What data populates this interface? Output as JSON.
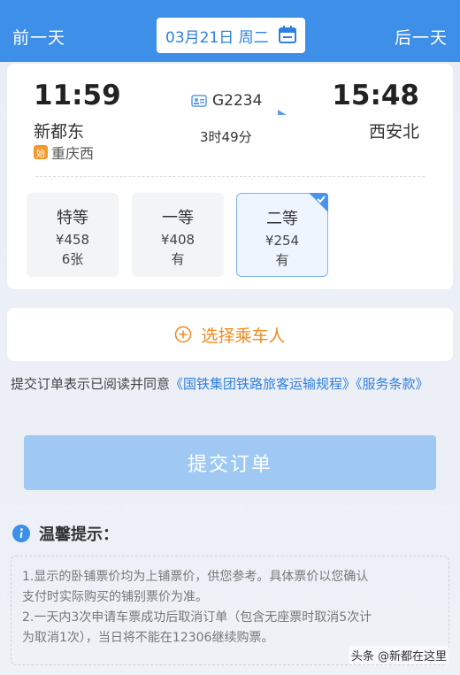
{
  "header": {
    "prev_label": "前一天",
    "next_label": "后一天",
    "date": "03月21日 周二"
  },
  "trip": {
    "dep_time": "11:59",
    "dep_station": "新都东",
    "origin_badge": "始",
    "origin_station": "重庆西",
    "train_no": "G2234",
    "duration": "3时49分",
    "arr_time": "15:48",
    "arr_station": "西安北"
  },
  "seats": [
    {
      "name": "特等",
      "price": "¥458",
      "avail": "6张",
      "selected": false
    },
    {
      "name": "一等",
      "price": "¥408",
      "avail": "有",
      "selected": false
    },
    {
      "name": "二等",
      "price": "¥254",
      "avail": "有",
      "selected": true
    }
  ],
  "passenger": {
    "select_label": "选择乘车人"
  },
  "agreement": {
    "prefix": "提交订单表示已阅读并同意",
    "link1": "《国铁集团铁路旅客运输规程》",
    "link2": "《服务条款》"
  },
  "submit_label": "提交订单",
  "tips": {
    "title": "温馨提示：",
    "lines": [
      "1.显示的卧铺票价均为上铺票价，供您参考。具体票价以您确认",
      "支付时实际购买的铺别票价为准。",
      "2.一天内3次申请车票成功后取消订单（包含无座票时取消5次计",
      "为取消1次），当日将不能在12306继续购票。"
    ]
  },
  "watermark": "头条 @新都在这里",
  "colors": {
    "brand_blue": "#3d8fe8",
    "link_blue": "#2f7fe0",
    "accent_orange": "#f08a1e",
    "submit_disabled": "#9fc9f3"
  }
}
